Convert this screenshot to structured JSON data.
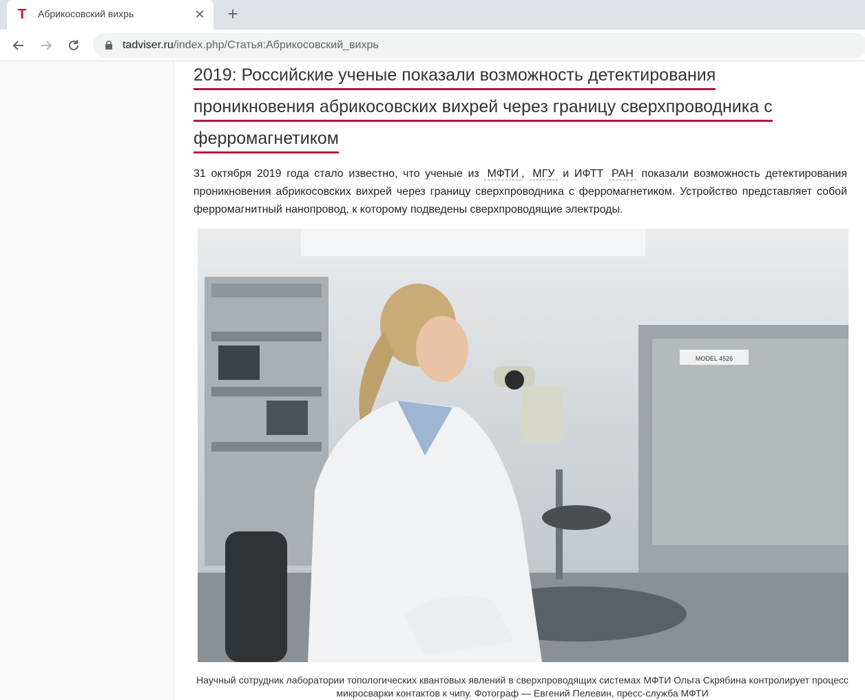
{
  "browser": {
    "tab_title": "Абрикосовский вихрь",
    "tab_favicon": "T",
    "new_tab_icon": "plus-icon",
    "url_domain": "tadviser.ru",
    "url_path": "/index.php/Статья:Абрикосовский_вихрь"
  },
  "article": {
    "heading_lines": [
      " 2019: Российские ученые показали возможность детектирования",
      "проникновения абрикосовских вихрей через границу сверхпроводника с",
      "ферромагнетиком"
    ],
    "para_prefix": "31 октября 2019 года стало известно, что ученые из ",
    "org_mfti": "МФТИ",
    "sep_comma": ", ",
    "org_mgu": "МГУ",
    "sep_and": " и ИФТТ ",
    "org_ran": "РАН",
    "para_suffix": " показали возможность детектирования проникновения абрикосовских вихрей через границу сверхпроводника с ферромагнетиком. Устройство представляет собой ферромагнитный нанопровод, к которому подведены сверхпроводящие электроды.",
    "photo_logo_text": "MODEL 4526",
    "caption_line1": "Научный сотрудник лаборатории топологических квантовых явлений в сверхпроводящих системах МФТИ Ольга Скрябина контролирует процесс",
    "caption_line2": "микросварки контактов к чипу. Фотограф — Евгений Пелевин, пресс-служба МФТИ"
  }
}
